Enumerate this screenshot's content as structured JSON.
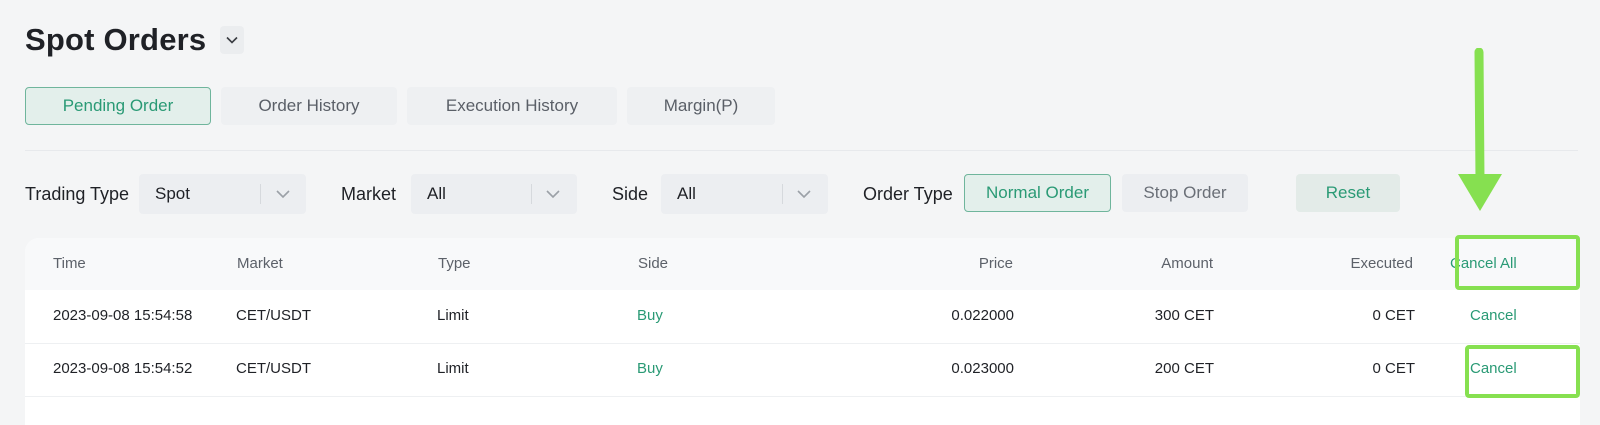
{
  "header": {
    "title": "Spot Orders"
  },
  "tabs": [
    {
      "label": "Pending Order",
      "active": true
    },
    {
      "label": "Order History",
      "active": false
    },
    {
      "label": "Execution History",
      "active": false
    },
    {
      "label": "Margin(P)",
      "active": false
    }
  ],
  "filters": {
    "trading_type": {
      "label": "Trading Type",
      "value": "Spot"
    },
    "market": {
      "label": "Market",
      "value": "All"
    },
    "side": {
      "label": "Side",
      "value": "All"
    },
    "order_type": {
      "label": "Order Type",
      "options": [
        "Normal Order",
        "Stop Order"
      ],
      "selected": "Normal Order"
    },
    "reset_label": "Reset"
  },
  "table": {
    "columns": [
      "Time",
      "Market",
      "Type",
      "Side",
      "Price",
      "Amount",
      "Executed"
    ],
    "cancel_all_label": "Cancel All",
    "rows": [
      {
        "time": "2023-09-08 15:54:58",
        "market": "CET/USDT",
        "type": "Limit",
        "side": "Buy",
        "price": "0.022000",
        "amount": "300 CET",
        "executed": "0 CET",
        "action": "Cancel"
      },
      {
        "time": "2023-09-08 15:54:52",
        "market": "CET/USDT",
        "type": "Limit",
        "side": "Buy",
        "price": "0.023000",
        "amount": "200 CET",
        "executed": "0 CET",
        "action": "Cancel"
      }
    ]
  },
  "colors": {
    "accent": "#2a9a75",
    "highlight": "#86e050",
    "background": "#f4f5f6"
  },
  "icons": {
    "title_dropdown": "chevron-down-icon",
    "select_dropdown": "chevron-down-icon",
    "annotation": "arrow-down-icon"
  }
}
